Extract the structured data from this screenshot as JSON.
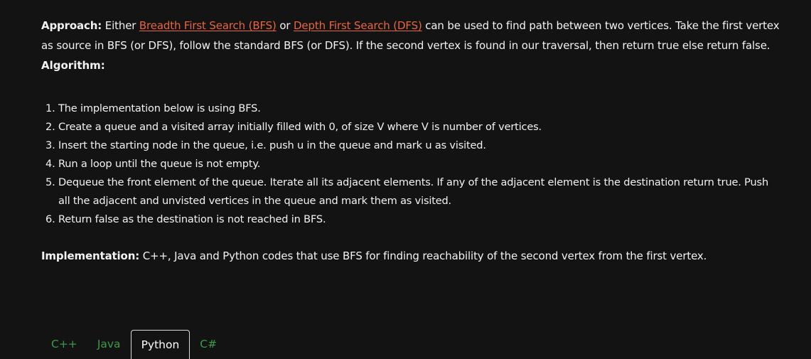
{
  "approach": {
    "label": "Approach:",
    "prefix": " Either ",
    "link_bfs": "Breadth First Search (BFS)",
    "middle": " or ",
    "link_dfs": "Depth First Search (DFS)",
    "suffix": " can be used to find path between two vertices. Take the first vertex as source in BFS (or DFS), follow the standard BFS (or DFS). If the second vertex is found in our traversal, then return true else return false."
  },
  "algorithm": {
    "heading": "Algorithm:",
    "steps": [
      "The implementation below is using BFS.",
      "Create a queue and a visited array initially filled with 0, of size V where V is number of vertices.",
      "Insert the starting node in the queue, i.e. push u in the queue and mark u as visited.",
      "Run a loop until the queue is not empty.",
      "Dequeue the front element of the queue. Iterate all its adjacent elements. If any of the adjacent element is the destination return true. Push all the adjacent and unvisted vertices in the queue and mark them as visited.",
      "Return false as the destination is not reached in BFS."
    ]
  },
  "implementation": {
    "label": "Implementation:",
    "text": " C++, Java and Python codes that use BFS for finding reachability of the second vertex from the first vertex."
  },
  "tabs": {
    "items": [
      "C++",
      "Java",
      "Python",
      "C#"
    ],
    "active": "Python"
  },
  "colors": {
    "background": "#131313",
    "link": "#e8663d",
    "tab_inactive": "#3d9a4a",
    "text": "#f2f2f2"
  }
}
